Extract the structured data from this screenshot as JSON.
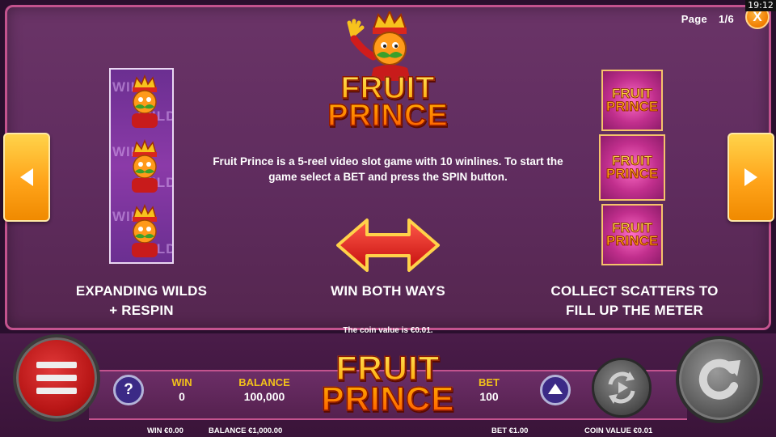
{
  "status": {
    "clock": "19:12"
  },
  "paytable": {
    "page_label": "Page",
    "page_number": "1/6",
    "close_symbol": "X",
    "logo_line1": "FRUIT",
    "logo_line2": "PRINCE",
    "description": "Fruit Prince is a 5-reel video slot game with 10 winlines. To start the game select a BET and press the SPIN button.",
    "features": {
      "left_line1": "EXPANDING WILDS",
      "left_line2": "+ RESPIN",
      "center": "WIN BOTH WAYS",
      "right_line1": "COLLECT SCATTERS TO",
      "right_line2": "FILL UP THE METER"
    },
    "wild_text": "WILD",
    "coin_note": "The coin value is €0.01."
  },
  "bottom_bar": {
    "help_symbol": "?",
    "win_label": "WIN",
    "win_value": "0",
    "balance_label": "BALANCE",
    "balance_value": "100,000",
    "bet_label": "BET",
    "bet_value": "100",
    "logo_line1": "FRUIT",
    "logo_line2": "PRINCE"
  },
  "footer": {
    "win": "WIN €0.00",
    "balance": "BALANCE €1,000.00",
    "bet": "BET €1.00",
    "coin_value": "COIN VALUE €0.01"
  },
  "colors": {
    "panel": "#5f2c5e",
    "panel_border": "#c3538e",
    "accent_orange": "#ffa41a",
    "label_yellow": "#f2c21a",
    "menu_red": "#b81616",
    "arrow_red": "#e41e1e"
  },
  "icons": [
    "close-icon",
    "arrow-left-icon",
    "arrow-right-icon",
    "double-arrow-icon",
    "menu-icon",
    "help-icon",
    "bet-up-icon",
    "autoplay-icon",
    "spin-icon"
  ]
}
